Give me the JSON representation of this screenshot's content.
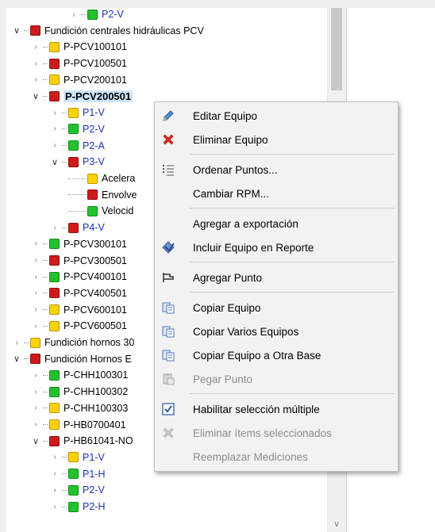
{
  "tree": {
    "rows": [
      {
        "label": "P2-V",
        "indent": 3,
        "color": "g",
        "expander": ">",
        "blue": true
      },
      {
        "label": "Fundición centrales hidráulicas PCV",
        "indent": 0,
        "color": "r",
        "expander": "v"
      },
      {
        "label": "P-PCV100101",
        "indent": 1,
        "color": "y",
        "expander": ">"
      },
      {
        "label": "P-PCV100501",
        "indent": 1,
        "color": "r",
        "expander": ">"
      },
      {
        "label": "P-PCV200101",
        "indent": 1,
        "color": "y",
        "expander": ">"
      },
      {
        "label": "P-PCV200501",
        "indent": 1,
        "color": "r",
        "expander": "v",
        "bold": true,
        "selected": true
      },
      {
        "label": "P1-V",
        "indent": 2,
        "color": "y",
        "expander": ">",
        "blue": true
      },
      {
        "label": "P2-V",
        "indent": 2,
        "color": "g",
        "expander": ">",
        "blue": true
      },
      {
        "label": "P2-A",
        "indent": 2,
        "color": "g",
        "expander": ">",
        "blue": true
      },
      {
        "label": "P3-V",
        "indent": 2,
        "color": "r",
        "expander": "v",
        "blue": true
      },
      {
        "label": "Acelera",
        "indent": 3,
        "color": "y",
        "expander": ""
      },
      {
        "label": "Envolve",
        "indent": 3,
        "color": "r",
        "expander": ""
      },
      {
        "label": "Velocid",
        "indent": 3,
        "color": "g",
        "expander": ""
      },
      {
        "label": "P4-V",
        "indent": 2,
        "color": "r",
        "expander": ">",
        "blue": true
      },
      {
        "label": "P-PCV300101",
        "indent": 1,
        "color": "g",
        "expander": ">"
      },
      {
        "label": "P-PCV300501",
        "indent": 1,
        "color": "r",
        "expander": ">"
      },
      {
        "label": "P-PCV400101",
        "indent": 1,
        "color": "g",
        "expander": ">"
      },
      {
        "label": "P-PCV400501",
        "indent": 1,
        "color": "r",
        "expander": ">"
      },
      {
        "label": "P-PCV600101",
        "indent": 1,
        "color": "y",
        "expander": ">"
      },
      {
        "label": "P-PCV600501",
        "indent": 1,
        "color": "y",
        "expander": ">"
      },
      {
        "label": "Fundición hornos 30",
        "indent": 0,
        "color": "y",
        "expander": ">"
      },
      {
        "label": "Fundición Hornos E",
        "indent": 0,
        "color": "r",
        "expander": "v"
      },
      {
        "label": "P-CHH100301",
        "indent": 1,
        "color": "g",
        "expander": ">"
      },
      {
        "label": "P-CHH100302",
        "indent": 1,
        "color": "g",
        "expander": ">"
      },
      {
        "label": "P-CHH100303",
        "indent": 1,
        "color": "y",
        "expander": ">"
      },
      {
        "label": "P-HB0700401",
        "indent": 1,
        "color": "y",
        "expander": ">"
      },
      {
        "label": "P-HB61041-NO",
        "indent": 1,
        "color": "r",
        "expander": "v"
      },
      {
        "label": "P1-V",
        "indent": 2,
        "color": "y",
        "expander": ">",
        "blue": true
      },
      {
        "label": "P1-H",
        "indent": 2,
        "color": "g",
        "expander": ">",
        "blue": true
      },
      {
        "label": "P2-V",
        "indent": 2,
        "color": "g",
        "expander": ">",
        "blue": true
      },
      {
        "label": "P2-H",
        "indent": 2,
        "color": "g",
        "expander": ">",
        "blue": true
      }
    ]
  },
  "scrollbar": {
    "down_arrow": "v"
  },
  "context_menu": {
    "items": [
      {
        "label": "Editar Equipo",
        "icon": "pencil-icon",
        "enabled": true
      },
      {
        "label": "Eliminar Equipo",
        "icon": "red-x-icon",
        "enabled": true,
        "sep_after": true
      },
      {
        "label": "Ordenar Puntos...",
        "icon": "list-order-icon",
        "enabled": true
      },
      {
        "label": "Cambiar RPM...",
        "icon": "",
        "enabled": true,
        "sep_after": true
      },
      {
        "label": "Agregar a exportación",
        "icon": "",
        "enabled": true
      },
      {
        "label": "Incluir Equipo en Reporte",
        "icon": "report-include-icon",
        "enabled": true,
        "sep_after": true
      },
      {
        "label": "Agregar Punto",
        "icon": "add-point-icon",
        "enabled": true,
        "sep_after": true
      },
      {
        "label": "Copiar Equipo",
        "icon": "copy-icon",
        "enabled": true
      },
      {
        "label": "Copiar Varios Equipos",
        "icon": "copy-icon",
        "enabled": true
      },
      {
        "label": "Copiar Equipo a Otra Base",
        "icon": "copy-icon",
        "enabled": true
      },
      {
        "label": "Pegar Punto",
        "icon": "paste-icon",
        "enabled": false,
        "sep_after": true
      },
      {
        "label": "Habilitar selección múltiple",
        "icon": "checkbox-icon",
        "enabled": true
      },
      {
        "label": "Eliminar ítems seleccionados",
        "icon": "grey-x-icon",
        "enabled": false
      },
      {
        "label": "Reemplazar Mediciones",
        "icon": "",
        "enabled": false
      }
    ]
  }
}
